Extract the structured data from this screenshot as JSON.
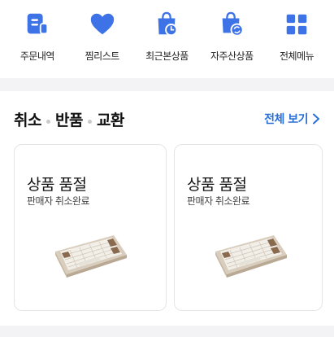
{
  "shortcuts": [
    {
      "label": "주문내역",
      "icon": "order-list-icon"
    },
    {
      "label": "찜리스트",
      "icon": "heart-icon"
    },
    {
      "label": "최근본상품",
      "icon": "recent-bag-icon"
    },
    {
      "label": "자주산상품",
      "icon": "repurchase-bag-icon"
    },
    {
      "label": "전체메뉴",
      "icon": "grid-menu-icon"
    }
  ],
  "section": {
    "title_parts": [
      "취소",
      "반품",
      "교환"
    ],
    "see_all": "전체 보기"
  },
  "cards": [
    {
      "status": "상품 품절",
      "sub": "판매자 취소완료",
      "image": "keyboard-thumbnail"
    },
    {
      "status": "상품 품절",
      "sub": "판매자 취소완료",
      "image": "keyboard-thumbnail"
    }
  ],
  "colors": {
    "accent": "#3d73e6",
    "link": "#2a6fd6",
    "divider": "#f3f3f5"
  }
}
